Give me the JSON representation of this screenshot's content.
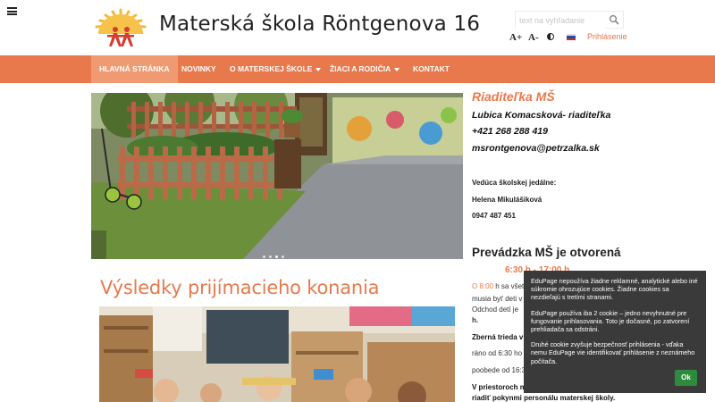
{
  "header": {
    "site_title": "Materská škola Röntgenova 16",
    "search_placeholder": "text na vyhľadanie",
    "font_increase": "A+",
    "font_decrease": "A-",
    "login": "Prihlásenie"
  },
  "nav": {
    "items": [
      {
        "label": "HLAVNÁ STRÁNKA",
        "active": true,
        "dropdown": false
      },
      {
        "label": "NOVINKY",
        "active": false,
        "dropdown": false
      },
      {
        "label": "O MATERSKEJ ŠKOLE",
        "active": false,
        "dropdown": true
      },
      {
        "label": "ŽIACI A RODIČIA",
        "active": false,
        "dropdown": true
      },
      {
        "label": "KONTAKT",
        "active": false,
        "dropdown": false
      }
    ]
  },
  "slider": {
    "slides_count": 4,
    "active_slide": 2
  },
  "article": {
    "title": "Výsledky prijímacieho konania"
  },
  "sidebar": {
    "director_title": "Riaditeľka MŠ",
    "director_name": "Lubica Komacsková- riaditeľka",
    "phone": "+421 268 288 419",
    "email": "msrontgenova@petrzalka.sk",
    "canteen_title": "Vedúca školskej jedálne:",
    "canteen_name": "Helena Mikulášiková",
    "canteen_phone": "0947 487 451",
    "open_title": "Prevádzka MŠ je otvorená",
    "open_hours": "6:30 h - 17:00 h",
    "line1_time": "O 8:00",
    "line1_text": "h sa všetky",
    "line2": "musia byť deti v",
    "line3": "Odchod detí je",
    "line4": "h.",
    "line5": "Zberná trieda v",
    "line6": "ráno od 6:30 ho",
    "line7": "poobede od 16:30 hod do 17:00 hod.",
    "line8": "V priestoroch materskej školy je potrebné sa",
    "line9": "riadiť pokynmi personálu materskej školy."
  },
  "cookie": {
    "p1": "EduPage nepoužíva žiadne reklamné, analytické alebo iné súkromie ohrozujúce cookies. Žiadne cookies sa nezdieľajú s tretími stranami.",
    "p2": "EduPage používa iba 2 cookie – jedno nevyhnutné pre fungovanie prihlasovania. Toto je dočasné, po zatvorení prehliadača sa odstráni.",
    "p3": "Druhé cookie zvyšuje bezpečnosť prihlásenia - vďaka nemu EduPage vie identifikovať prihlásenie z neznámeho počítača.",
    "ok": "Ok"
  },
  "colors": {
    "accent": "#e8794c",
    "nav_active": "#f09a72",
    "cookie_bg": "#3a3a3a",
    "cookie_ok": "#2e8b3e"
  },
  "icons": {
    "menu": "hamburger-icon",
    "search": "search-icon",
    "contrast": "contrast-icon",
    "language": "slovak-flag-icon"
  }
}
